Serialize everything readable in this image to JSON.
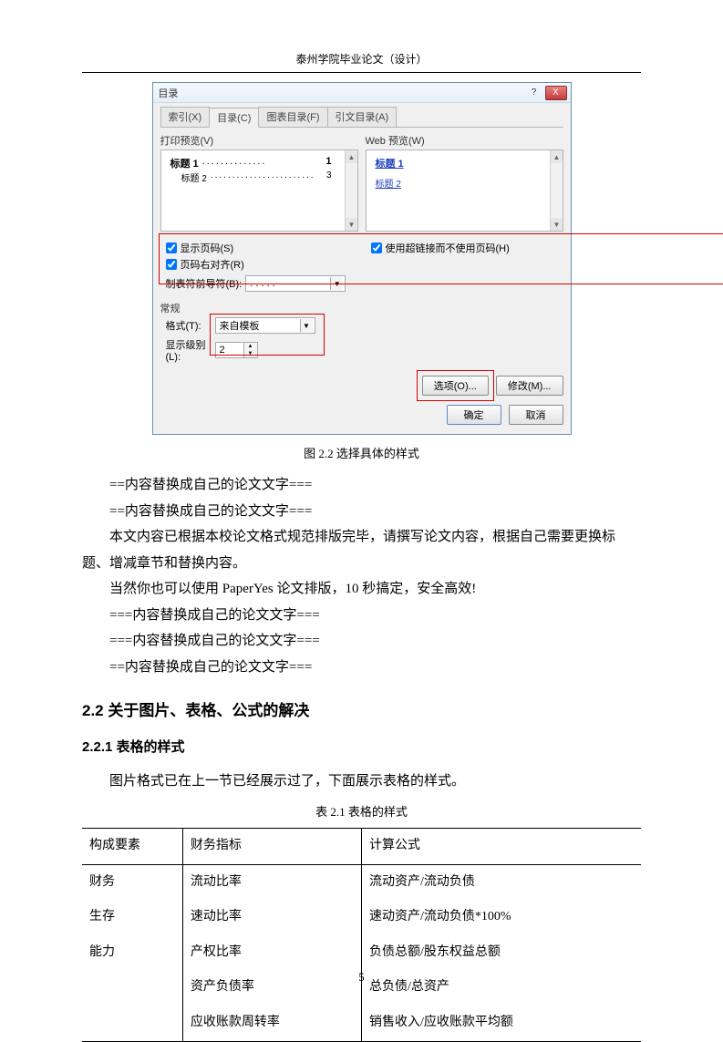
{
  "header": {
    "title": "泰州学院毕业论文（设计）"
  },
  "dialog": {
    "title": "目录",
    "help": "?",
    "close": "X",
    "tabs": {
      "t1": "索引(X)",
      "t2": "目录(C)",
      "t3": "图表目录(F)",
      "t4": "引文目录(A)"
    },
    "print_preview_label": "打印预览(V)",
    "web_preview_label": "Web 预览(W)",
    "print_preview": {
      "h1": "标题 1",
      "h1_page": "1",
      "h2": "标题 2",
      "h2_page": "3"
    },
    "web_preview": {
      "h1": "标题 1",
      "h2": "标题 2"
    },
    "show_page_num": "显示页码(S)",
    "right_align": "页码右对齐(R)",
    "hyperlink": "使用超链接而不使用页码(H)",
    "leader_label": "制表符前导符(B):",
    "leader_value": ". . . . .",
    "general_label": "常规",
    "format_label": "格式(T):",
    "format_value": "来自模板",
    "level_label": "显示级别(L):",
    "level_value": "2",
    "btn_options": "选项(O)...",
    "btn_modify": "修改(M)...",
    "btn_ok": "确定",
    "btn_cancel": "取消"
  },
  "figure_caption": "图 2.2 选择具体的样式",
  "body": {
    "p1": "==内容替换成自己的论文文字===",
    "p2": "==内容替换成自己的论文文字===",
    "p3": "本文内容已根据本校论文格式规范排版完毕，请撰写论文内容，根据自己需要更换标题、增减章节和替换内容。",
    "p4": "当然你也可以使用 PaperYes 论文排版，10 秒搞定，安全高效!",
    "p5": "===内容替换成自己的论文文字===",
    "p6": "===内容替换成自己的论文文字===",
    "p7": "==内容替换成自己的论文文字==="
  },
  "headings": {
    "h22": "2.2  关于图片、表格、公式的解决",
    "h221": "2.2.1  表格的样式"
  },
  "table_intro": "图片格式已在上一节已经展示过了，下面展示表格的样式。",
  "table_caption": "表 2.1  表格的样式",
  "table": {
    "headers": {
      "c1": "构成要素",
      "c2": "财务指标",
      "c3": "计算公式"
    },
    "rows": [
      {
        "c1": "财务",
        "c2": "流动比率",
        "c3": "流动资产/流动负债"
      },
      {
        "c1": "生存",
        "c2": "速动比率",
        "c3": "速动资产/流动负债*100%"
      },
      {
        "c1": "能力",
        "c2": "产权比率",
        "c3": "负债总额/股东权益总额"
      },
      {
        "c1": "",
        "c2": "资产负债率",
        "c3": "总负债/总资产"
      },
      {
        "c1": "",
        "c2": "应收账款周转率",
        "c3": "销售收入/应收账款平均额"
      }
    ]
  },
  "page_number": "5"
}
